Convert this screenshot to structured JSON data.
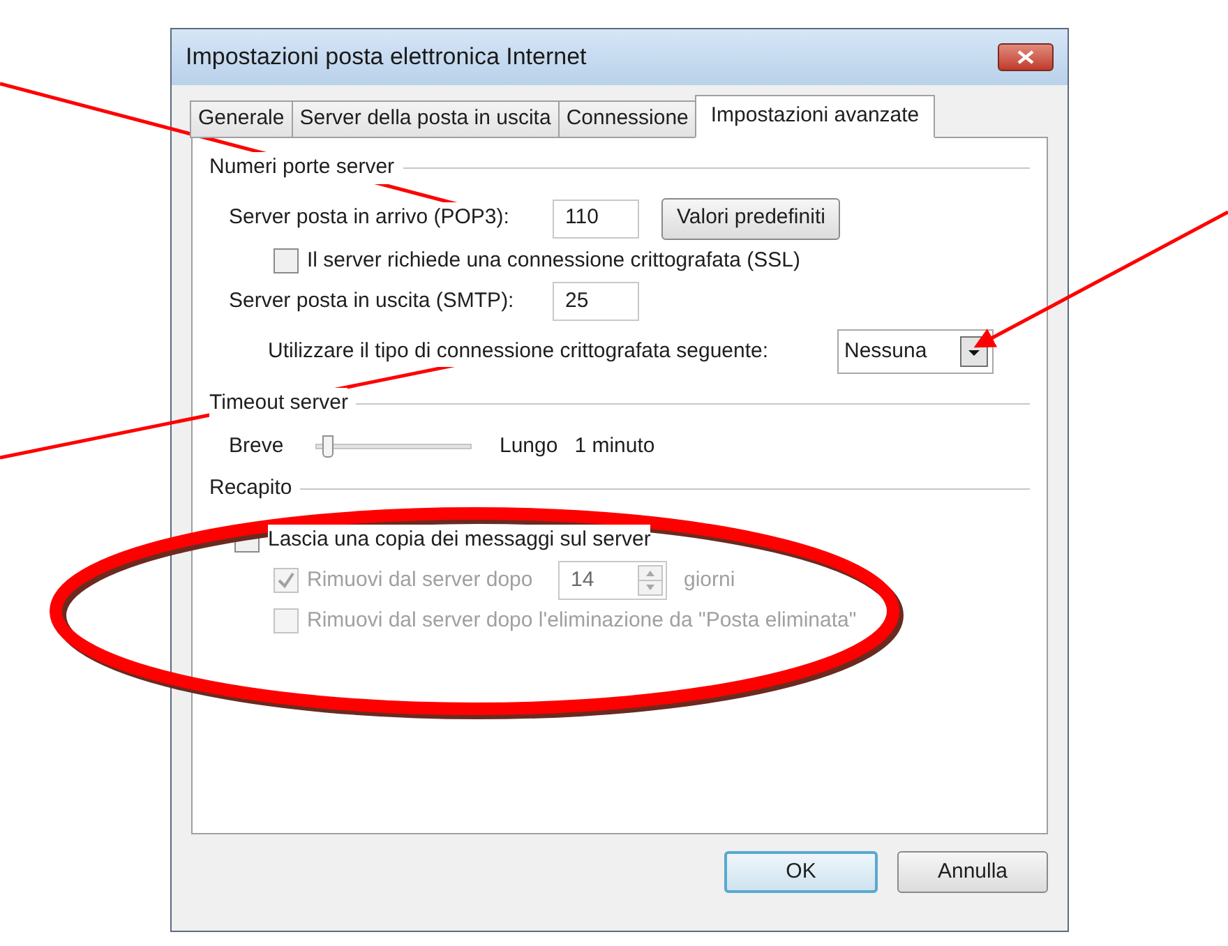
{
  "window": {
    "title": "Impostazioni posta elettronica Internet"
  },
  "tabs": [
    {
      "label": "Generale",
      "selected": false
    },
    {
      "label": "Server della posta in uscita",
      "selected": false
    },
    {
      "label": "Connessione",
      "selected": false
    },
    {
      "label": "Impostazioni avanzate",
      "selected": true
    }
  ],
  "ports": {
    "title": "Numeri porte server",
    "incoming_label": "Server posta in arrivo (POP3):",
    "incoming_value": "110",
    "defaults_button": "Valori predefiniti",
    "ssl": {
      "label": "Il server richiede una connessione crittografata (SSL)",
      "checked": false
    },
    "outgoing_label": "Server posta in uscita (SMTP):",
    "outgoing_value": "25",
    "encryption_label": "Utilizzare il tipo di connessione crittografata seguente:",
    "encryption_value": "Nessuna"
  },
  "timeout": {
    "title": "Timeout server",
    "min_label": "Breve",
    "max_label": "Lungo",
    "level": 0.05,
    "reading": "1 minuto"
  },
  "delivery": {
    "title": "Recapito",
    "leave_copy": {
      "label": "Lascia una copia dei messaggi sul server",
      "checked": false,
      "disabled": false
    },
    "remove_after": {
      "label": "Rimuovi dal server dopo",
      "checked": true,
      "disabled": true,
      "value": "14",
      "unit": "giorni"
    },
    "remove_on_delete": {
      "label": "Rimuovi dal server dopo l'eliminazione da \"Posta eliminata\"",
      "checked": false,
      "disabled": true
    }
  },
  "buttons": [
    {
      "label": "OK",
      "kind": "default"
    },
    {
      "label": "Annulla",
      "kind": "normal"
    }
  ]
}
